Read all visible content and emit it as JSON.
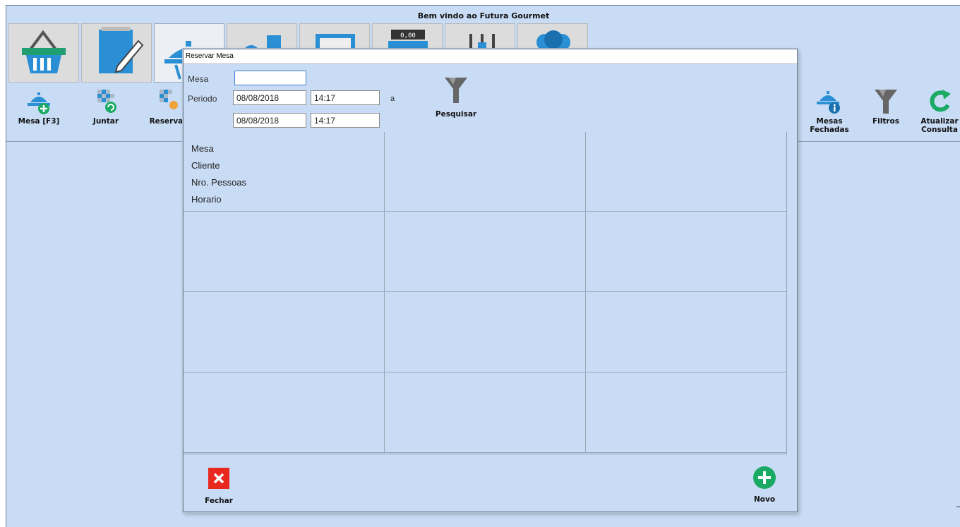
{
  "app": {
    "title": "Bem vindo ao Futura Gourmet"
  },
  "nav_tabs": [
    {
      "icon": "basket-icon"
    },
    {
      "icon": "notepad-pencil-icon"
    },
    {
      "icon": "waiter-cloche-icon"
    },
    {
      "icon": "delivery-icon"
    },
    {
      "icon": "picture-icon"
    },
    {
      "icon": "cash-register-icon"
    },
    {
      "icon": "settings-sliders-icon"
    },
    {
      "icon": "users-icon"
    }
  ],
  "toolbar": {
    "mesa": "Mesa [F3]",
    "juntar": "Juntar",
    "reservar": "Reservar",
    "mesas_fechadas_1": "Mesas",
    "mesas_fechadas_2": "Fechadas",
    "filtros": "Filtros",
    "atualizar_1": "Atualizar",
    "atualizar_2": "Consulta"
  },
  "dialog": {
    "title": "Reservar Mesa",
    "mesa_label": "Mesa",
    "mesa_value": "",
    "periodo_label": "Periodo",
    "start_date": "08/08/2018",
    "start_time": "14:17",
    "separator": "a",
    "end_date": "08/08/2018",
    "end_time": "14:17",
    "search_label": "Pesquisar",
    "card_fields": [
      "Mesa",
      "Cliente",
      "Nro. Pessoas",
      "Horario"
    ],
    "close_label": "Fechar",
    "new_label": "Novo"
  },
  "colors": {
    "background": "#c9dcf5",
    "close_red": "#e8281f",
    "new_green": "#1aaa63",
    "icon_blue": "#2a8fd4"
  }
}
